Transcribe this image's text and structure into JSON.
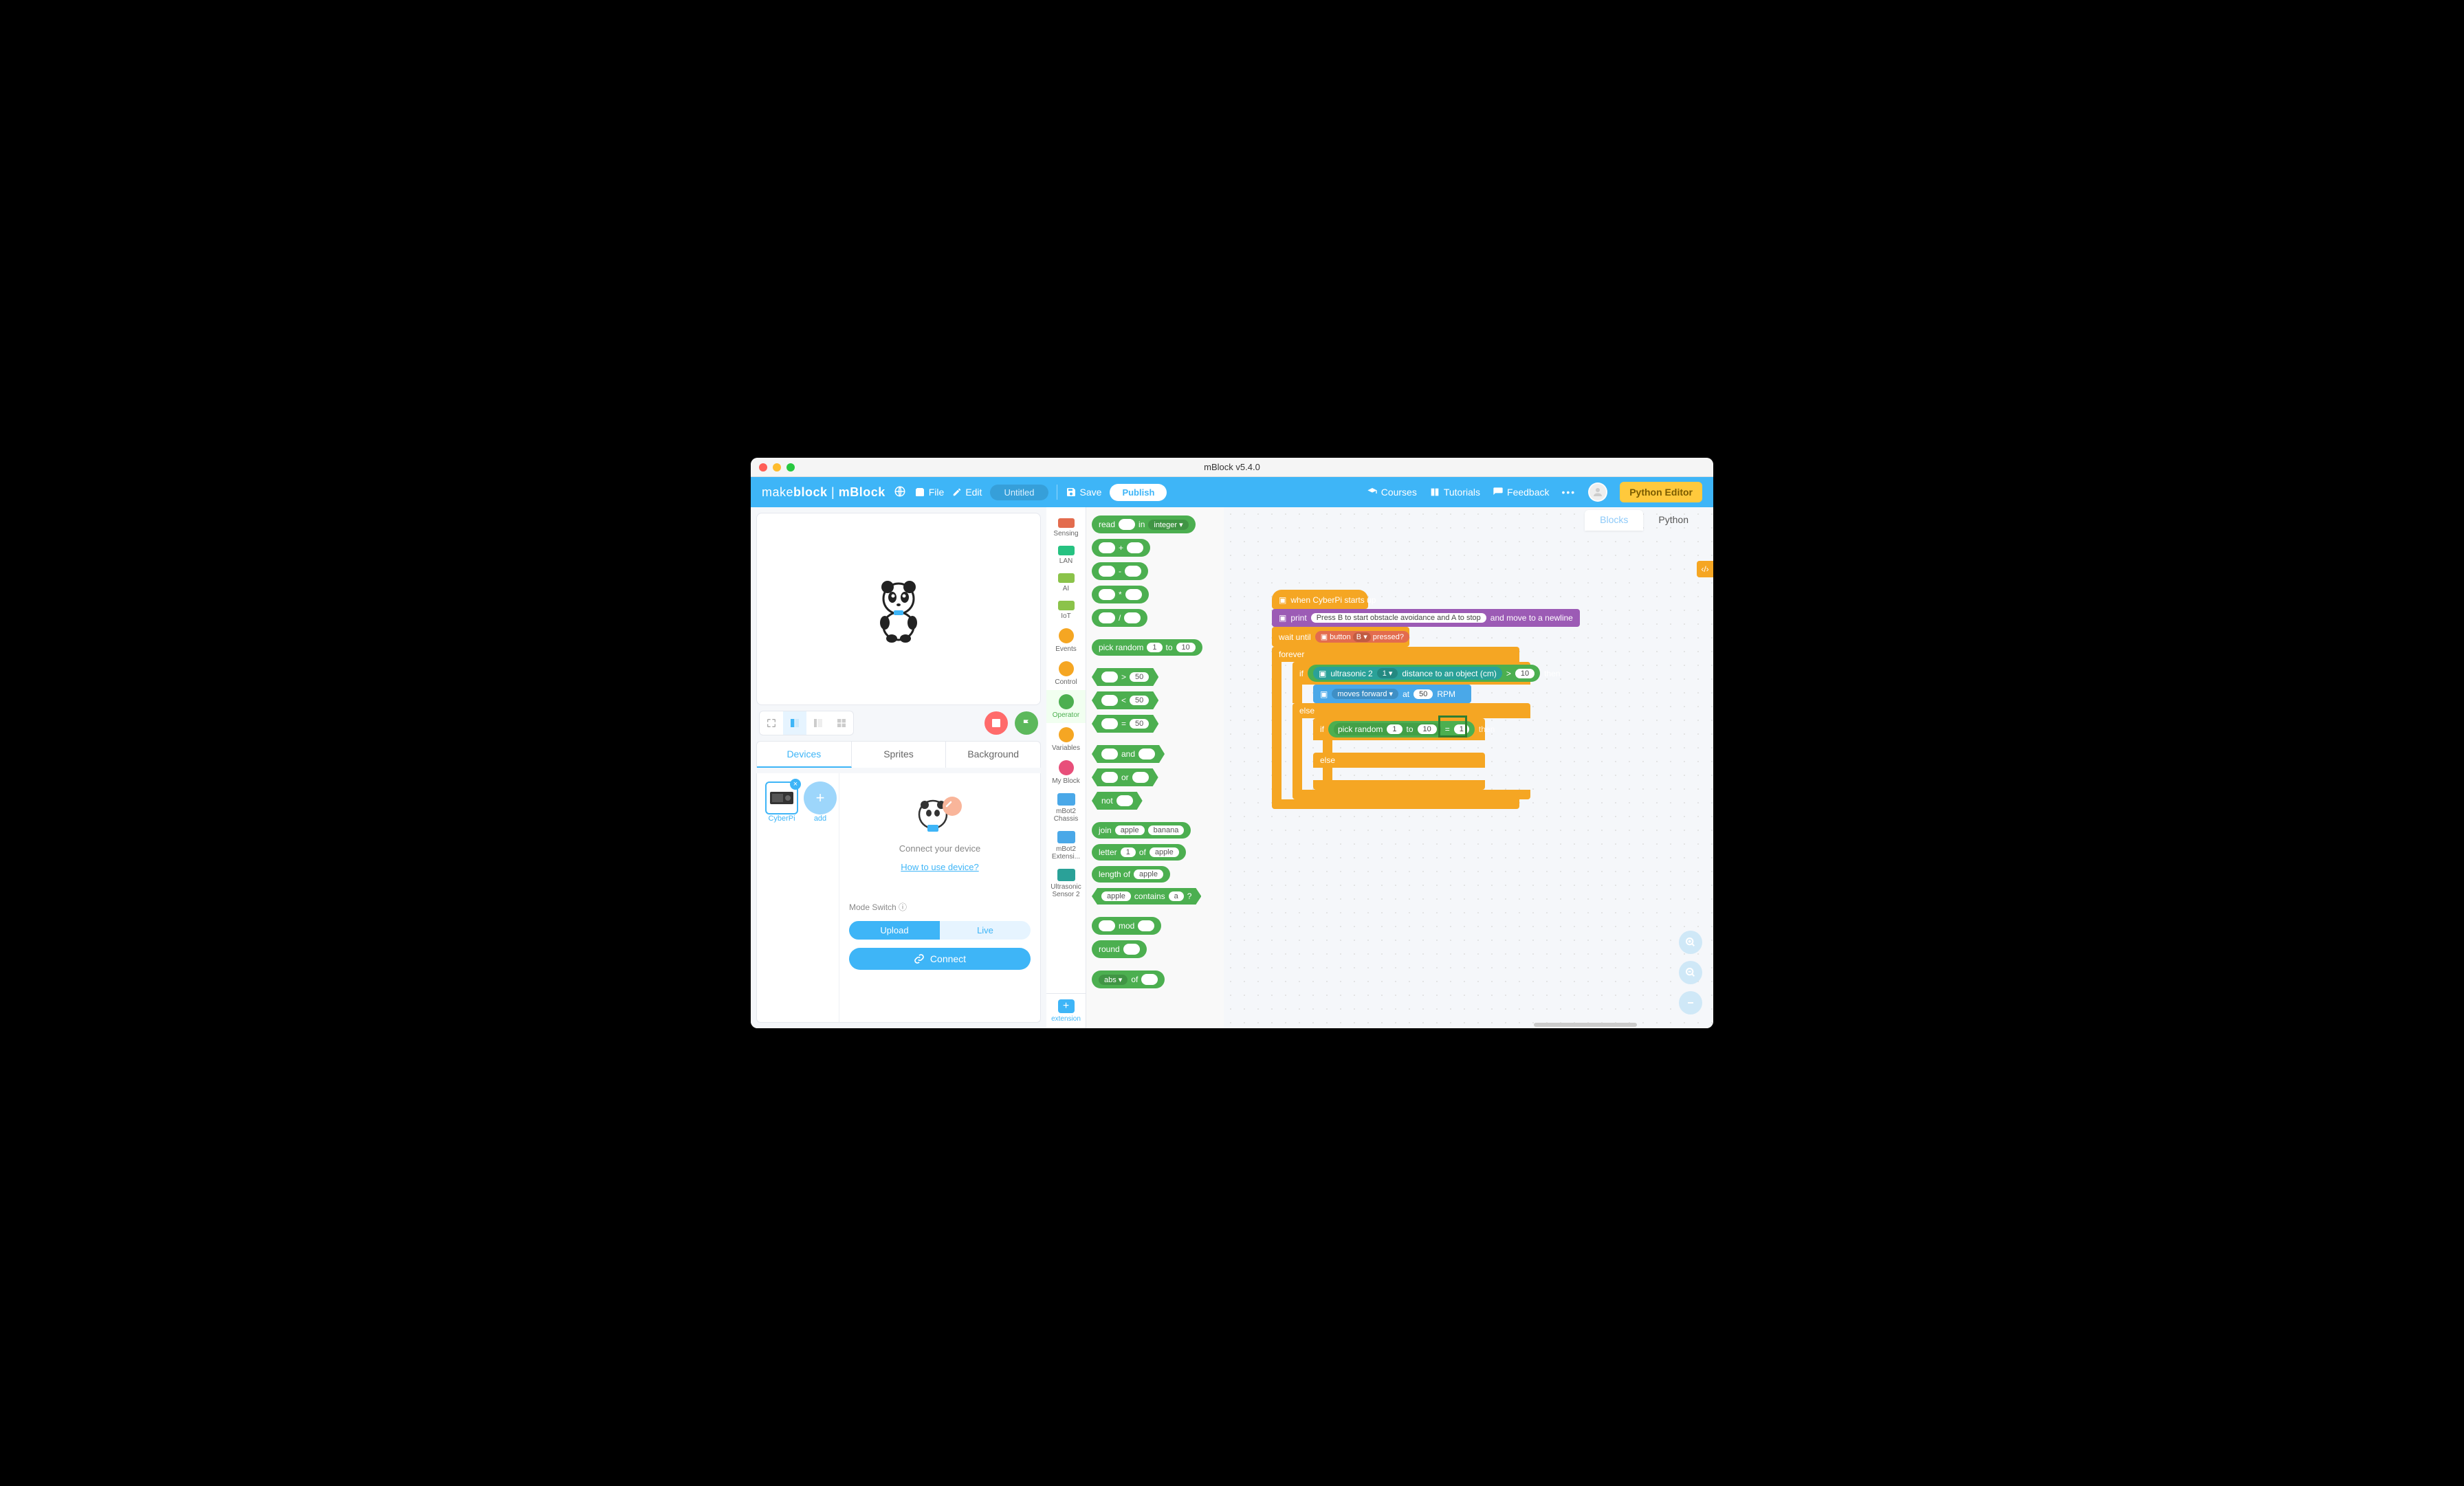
{
  "window": {
    "title": "mBlock v5.4.0"
  },
  "topbar": {
    "brand_make": "make",
    "brand_block": "block",
    "brand_mblock": "mBlock",
    "file": "File",
    "edit": "Edit",
    "project_name": "Untitled",
    "save": "Save",
    "publish": "Publish",
    "courses": "Courses",
    "tutorials": "Tutorials",
    "feedback": "Feedback",
    "python_editor": "Python Editor"
  },
  "categories": [
    {
      "label": "Sensing",
      "type": "rect",
      "color": "#e36c4e"
    },
    {
      "label": "LAN",
      "type": "rect",
      "color": "#26c281"
    },
    {
      "label": "AI",
      "type": "rect",
      "color": "#8bc34a"
    },
    {
      "label": "IoT",
      "type": "rect",
      "color": "#8bc34a"
    },
    {
      "label": "Events",
      "type": "dot",
      "color": "#f5a623"
    },
    {
      "label": "Control",
      "type": "dot",
      "color": "#f5a623"
    },
    {
      "label": "Operator",
      "type": "dot",
      "color": "#4CAF50",
      "active": true
    },
    {
      "label": "Variables",
      "type": "dot",
      "color": "#f5a623"
    },
    {
      "label": "My Block",
      "type": "dot",
      "color": "#e84f7a"
    },
    {
      "label": "mBot2 Chassis",
      "type": "chip",
      "color": "#4aa8e8"
    },
    {
      "label": "mBot2 Extensi...",
      "type": "chip",
      "color": "#4aa8e8"
    },
    {
      "label": "Ultrasonic Sensor 2",
      "type": "chip",
      "color": "#2aa198"
    }
  ],
  "extension": "extension",
  "palette": {
    "read": "read",
    "in": "in",
    "integer": "integer ▾",
    "plus": "+",
    "minus": "-",
    "times": "*",
    "divide": "/",
    "pick_random": "pick random",
    "to": "to",
    "rand_a": "1",
    "rand_b": "10",
    "gt": ">",
    "lt": "<",
    "eq": "=",
    "cmp_val": "50",
    "and": "and",
    "or": "or",
    "not": "not",
    "join": "join",
    "apple": "apple",
    "banana": "banana",
    "letter": "letter",
    "letter_n": "1",
    "of": "of",
    "length_of": "length of",
    "contains": "contains",
    "a": "a",
    "q": "?",
    "mod": "mod",
    "round": "round",
    "abs": "abs ▾",
    "of2": "of"
  },
  "tabs": {
    "devices": "Devices",
    "sprites": "Sprites",
    "background": "Background"
  },
  "devices": {
    "cyberpi": "CyberPi",
    "add": "add",
    "connect_prompt": "Connect your device",
    "how_to": "How to use device?",
    "mode_switch": "Mode Switch",
    "upload": "Upload",
    "live": "Live",
    "connect": "Connect"
  },
  "workspace": {
    "tabs": {
      "blocks": "Blocks",
      "python": "Python"
    },
    "hat": "when CyberPi starts up",
    "print": "print",
    "print_text": "Press B to start obstacle avoidance and A to stop",
    "print_tail": "and move to a newline",
    "wait_until": "wait until",
    "button": "button",
    "button_b": "B ▾",
    "pressed": "pressed?",
    "forever": "forever",
    "if": "if",
    "then": "then",
    "else": "else",
    "ultrasonic": "ultrasonic 2",
    "port": "1 ▾",
    "distance": "distance to an object (cm)",
    "gt": ">",
    "dist_val": "10",
    "moves_forward": "moves forward ▾",
    "at": "at",
    "rpm_val": "50",
    "rpm": "RPM",
    "pick_random": "pick random",
    "rand_a": "1",
    "to": "to",
    "rand_b": "10",
    "eq": "=",
    "eq_val": "1"
  }
}
